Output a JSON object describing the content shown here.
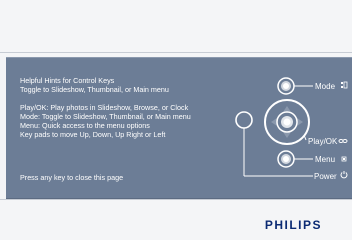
{
  "hints": {
    "title": "Helpful Hints for Control Keys",
    "toggle_line": "Toggle to Slideshow, Thumbnail, or Main menu",
    "play_ok": "Play/OK: Play photos in Slideshow, Browse, or Clock",
    "mode": "Mode: Toggle to Slideshow, Thumbnail, or Main menu",
    "menu": "Menu: Quick access to the menu options",
    "keypads": "Key pads to move Up, Down, Up Right or Left",
    "close": "Press any key to close this page"
  },
  "labels": {
    "mode": "Mode",
    "play_ok": "Play/OK",
    "menu": "Menu",
    "power": "Power"
  },
  "icons": {
    "mode": "mode-icon",
    "play_ok": "infinity-icon",
    "menu": "menu-icon",
    "power": "power-icon"
  },
  "brand": "PHILIPS",
  "colors": {
    "panel": "#6c7d96",
    "brand": "#0b2a73",
    "text": "#ffffff"
  }
}
